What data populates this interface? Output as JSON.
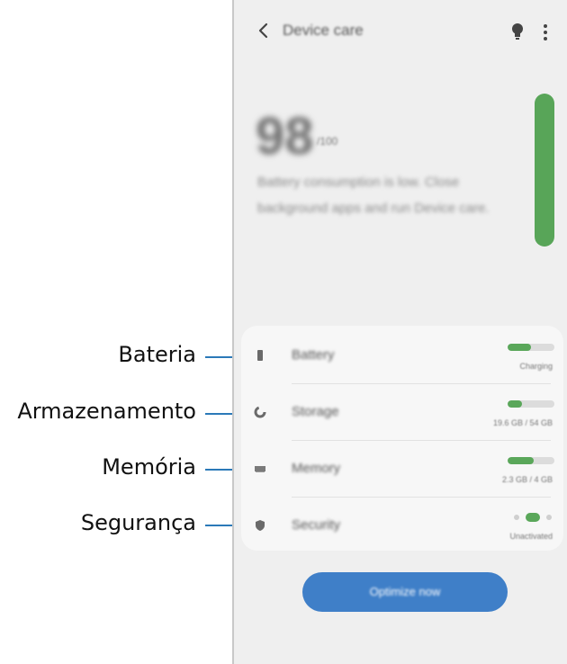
{
  "screen": {
    "title": "Device care",
    "score": "98",
    "score_unit": "/100",
    "description": "Battery consumption is low. Close background apps and run Device care.",
    "optimize_label": "Optimize now"
  },
  "items": [
    {
      "label": "Battery",
      "status": "Charging",
      "icon": "battery-icon",
      "level": 0.5
    },
    {
      "label": "Storage",
      "status": "19.6 GB / 54 GB",
      "icon": "storage-icon",
      "level": 0.3
    },
    {
      "label": "Memory",
      "status": "2.3 GB / 4 GB",
      "icon": "memory-icon",
      "level": 0.55
    },
    {
      "label": "Security",
      "status": "Unactivated",
      "icon": "shield-icon"
    }
  ],
  "callouts": {
    "battery": "Bateria",
    "storage": "Armazenamento",
    "memory": "Memória",
    "security": "Segurança"
  },
  "colors": {
    "accent_green": "#5aa75a",
    "button_blue": "#3f7fc8",
    "leader_blue": "#2b79b8"
  }
}
